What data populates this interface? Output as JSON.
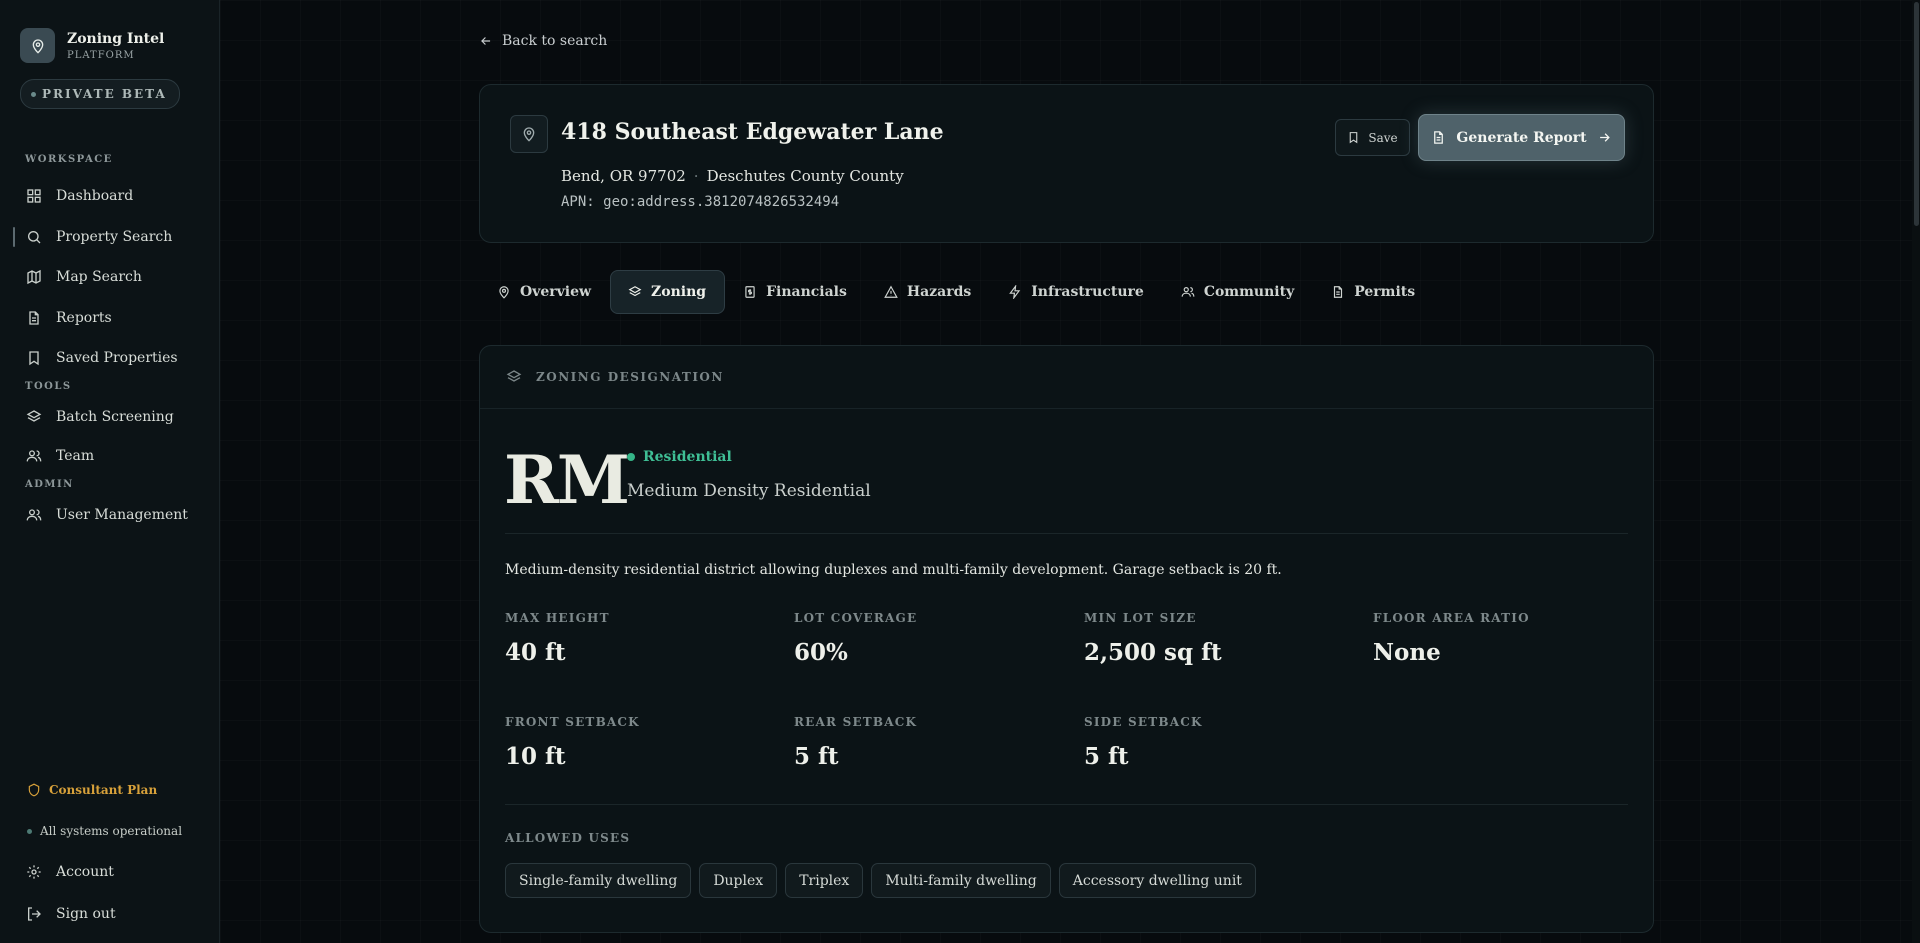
{
  "brand": {
    "name": "Zoning Intel",
    "sub": "PLATFORM",
    "badge": "PRIVATE BETA"
  },
  "sidebar": {
    "workspace_label": "WORKSPACE",
    "workspace_items": [
      {
        "label": "Dashboard",
        "icon": "grid-icon"
      },
      {
        "label": "Property Search",
        "icon": "search-icon"
      },
      {
        "label": "Map Search",
        "icon": "map-icon"
      },
      {
        "label": "Reports",
        "icon": "document-icon"
      },
      {
        "label": "Saved Properties",
        "icon": "bookmark-icon"
      }
    ],
    "tools_label": "TOOLS",
    "tools_items": [
      {
        "label": "Batch Screening",
        "icon": "layers-icon"
      },
      {
        "label": "Team",
        "icon": "users-icon"
      }
    ],
    "admin_label": "ADMIN",
    "admin_items": [
      {
        "label": "User Management",
        "icon": "users-icon"
      }
    ],
    "plan": "Consultant Plan",
    "status": "All systems operational",
    "account": "Account",
    "signout": "Sign out"
  },
  "back_link": "Back to search",
  "property": {
    "title": "418 Southeast Edgewater Lane",
    "city_state_zip": "Bend, OR 97702",
    "separator": "·",
    "county": "Deschutes County County",
    "apn": "APN: geo:address.3812074826532494"
  },
  "actions": {
    "save": "Save",
    "generate": "Generate Report"
  },
  "tabs": [
    {
      "label": "Overview",
      "icon": "map-pin-icon"
    },
    {
      "label": "Zoning",
      "icon": "layers-icon"
    },
    {
      "label": "Financials",
      "icon": "dollar-document-icon"
    },
    {
      "label": "Hazards",
      "icon": "warning-icon"
    },
    {
      "label": "Infrastructure",
      "icon": "lightning-icon"
    },
    {
      "label": "Community",
      "icon": "users-icon"
    },
    {
      "label": "Permits",
      "icon": "document-icon"
    }
  ],
  "zoning": {
    "header": "ZONING DESIGNATION",
    "code": "RM",
    "category": "Residential",
    "name": "Medium Density Residential",
    "description": "Medium-density residential district allowing duplexes and multi-family development. Garage setback is 20 ft.",
    "stats": [
      {
        "label": "MAX HEIGHT",
        "value": "40 ft"
      },
      {
        "label": "LOT COVERAGE",
        "value": "60%"
      },
      {
        "label": "MIN LOT SIZE",
        "value": "2,500 sq ft"
      },
      {
        "label": "FLOOR AREA RATIO",
        "value": "None"
      },
      {
        "label": "FRONT SETBACK",
        "value": "10 ft"
      },
      {
        "label": "REAR SETBACK",
        "value": "5 ft"
      },
      {
        "label": "SIDE SETBACK",
        "value": "5 ft"
      }
    ],
    "uses_label": "ALLOWED USES",
    "uses": [
      "Single-family dwelling",
      "Duplex",
      "Triplex",
      "Multi-family dwelling",
      "Accessory dwelling unit"
    ]
  },
  "colors": {
    "accent_green": "#35b588",
    "plan_gold": "#d8a13a",
    "button": "#4f626a",
    "background": "#070b0e"
  }
}
